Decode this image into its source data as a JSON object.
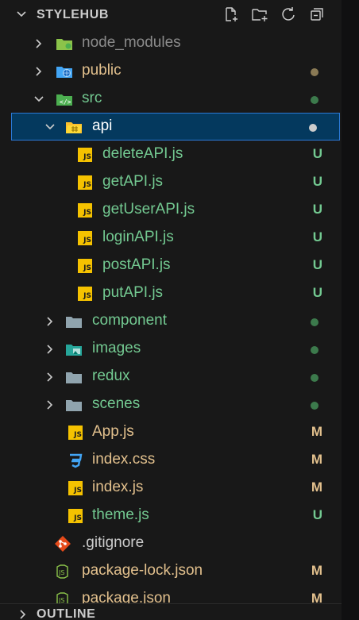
{
  "explorer": {
    "title": "STYLEHUB",
    "actions": [
      {
        "name": "new-file-icon"
      },
      {
        "name": "new-folder-icon"
      },
      {
        "name": "refresh-icon"
      },
      {
        "name": "collapse-all-icon"
      }
    ]
  },
  "tree": [
    {
      "label": "node_modules",
      "kind": "folder",
      "icon": "folder-node-icon",
      "depth": 0,
      "expanded": false,
      "color": "#8b8b8b",
      "badge": "",
      "dot": ""
    },
    {
      "label": "public",
      "kind": "folder",
      "icon": "folder-public-icon",
      "depth": 0,
      "expanded": false,
      "color": "#e2c08d",
      "badge": "",
      "dot": "#8a7a55"
    },
    {
      "label": "src",
      "kind": "folder",
      "icon": "folder-src-icon",
      "depth": 0,
      "expanded": true,
      "color": "#73c991",
      "badge": "",
      "dot": "#3c7a4c"
    },
    {
      "label": "api",
      "kind": "folder",
      "icon": "folder-api-icon",
      "depth": 1,
      "expanded": true,
      "color": "#ffffff",
      "badge": "",
      "dot": "#cccccc",
      "selected": true
    },
    {
      "label": "deleteAPI.js",
      "kind": "file",
      "icon": "js-file-icon",
      "depth": 2,
      "color": "#73c991",
      "badge": "U",
      "badge_color": "#73c991"
    },
    {
      "label": "getAPI.js",
      "kind": "file",
      "icon": "js-file-icon",
      "depth": 2,
      "color": "#73c991",
      "badge": "U",
      "badge_color": "#73c991"
    },
    {
      "label": "getUserAPI.js",
      "kind": "file",
      "icon": "js-file-icon",
      "depth": 2,
      "color": "#73c991",
      "badge": "U",
      "badge_color": "#73c991"
    },
    {
      "label": "loginAPI.js",
      "kind": "file",
      "icon": "js-file-icon",
      "depth": 2,
      "color": "#73c991",
      "badge": "U",
      "badge_color": "#73c991"
    },
    {
      "label": "postAPI.js",
      "kind": "file",
      "icon": "js-file-icon",
      "depth": 2,
      "color": "#73c991",
      "badge": "U",
      "badge_color": "#73c991"
    },
    {
      "label": "putAPI.js",
      "kind": "file",
      "icon": "js-file-icon",
      "depth": 2,
      "color": "#73c991",
      "badge": "U",
      "badge_color": "#73c991"
    },
    {
      "label": "component",
      "kind": "folder",
      "icon": "folder-icon",
      "depth": 1,
      "expanded": false,
      "color": "#73c991",
      "badge": "",
      "dot": "#3c7a4c"
    },
    {
      "label": "images",
      "kind": "folder",
      "icon": "folder-images-icon",
      "depth": 1,
      "expanded": false,
      "color": "#73c991",
      "badge": "",
      "dot": "#3c7a4c"
    },
    {
      "label": "redux",
      "kind": "folder",
      "icon": "folder-icon",
      "depth": 1,
      "expanded": false,
      "color": "#73c991",
      "badge": "",
      "dot": "#3c7a4c"
    },
    {
      "label": "scenes",
      "kind": "folder",
      "icon": "folder-icon",
      "depth": 1,
      "expanded": false,
      "color": "#73c991",
      "badge": "",
      "dot": "#3c7a4c"
    },
    {
      "label": "App.js",
      "kind": "file",
      "icon": "js-file-icon",
      "depth": 1,
      "color": "#e2c08d",
      "badge": "M",
      "badge_color": "#e2c08d"
    },
    {
      "label": "index.css",
      "kind": "file",
      "icon": "css-file-icon",
      "depth": 1,
      "color": "#e2c08d",
      "badge": "M",
      "badge_color": "#e2c08d"
    },
    {
      "label": "index.js",
      "kind": "file",
      "icon": "js-file-icon",
      "depth": 1,
      "color": "#e2c08d",
      "badge": "M",
      "badge_color": "#e2c08d"
    },
    {
      "label": "theme.js",
      "kind": "file",
      "icon": "js-file-icon",
      "depth": 1,
      "color": "#73c991",
      "badge": "U",
      "badge_color": "#73c991"
    },
    {
      "label": ".gitignore",
      "kind": "file",
      "icon": "git-file-icon",
      "depth": 0,
      "color": "#cccccc",
      "badge": "",
      "badge_color": ""
    },
    {
      "label": "package-lock.json",
      "kind": "file",
      "icon": "json-file-icon",
      "depth": 0,
      "color": "#e2c08d",
      "badge": "M",
      "badge_color": "#e2c08d"
    },
    {
      "label": "package.json",
      "kind": "file",
      "icon": "json-file-icon",
      "depth": 0,
      "color": "#e2c08d",
      "badge": "M",
      "badge_color": "#e2c08d"
    }
  ],
  "outline": {
    "title": "OUTLINE"
  }
}
